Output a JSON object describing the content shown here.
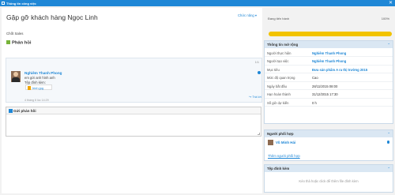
{
  "window": {
    "title": "Thông tin công việc",
    "close_glyph": "✕",
    "icon": "window-icon"
  },
  "task": {
    "title": "Gặp gỡ khách hàng Ngọc Linh",
    "choice_label": "Chức năng ▾",
    "subtitle": "Chốt Sales"
  },
  "feedback": {
    "heading": "Phản hồi",
    "count": "1/1",
    "comment": {
      "author": "Nghiêm Thanh Phong",
      "message": "em gửi anh hình anh",
      "attachments_label": "Tệp đính kèm:",
      "file_name": "hinh.jpg",
      "time": "4 tháng 6 lúc 14:29",
      "reply_label": "↪ Trả lời"
    },
    "compose": {
      "title": "Gửi phản hồi",
      "placeholder": ""
    }
  },
  "progress": {
    "label": "Đang tiến hành",
    "percent_text": "100%",
    "value": 1.0,
    "color": "#f2c300"
  },
  "info": {
    "title": "Thông tin mở rộng",
    "rows": [
      {
        "key": "Người thực hiện",
        "value": "Nghiêm Thanh Phong",
        "link": true
      },
      {
        "key": "Người tạo việc",
        "value": "Nghiêm Thanh Phong",
        "link": true
      },
      {
        "key": "Mục tiêu",
        "value": "Đưa sản phẩm A ra thị trường 2015",
        "link": true
      },
      {
        "key": "Mức độ quan trọng",
        "value": "Cao",
        "link": false
      },
      {
        "key": "Ngày bắt đầu",
        "value": "28/11/2015 08:00",
        "link": false
      },
      {
        "key": "Hạn hoàn thành",
        "value": "31/12/2015 17:30",
        "link": false
      },
      {
        "key": "Số giờ dự kiến",
        "value": "0 h",
        "link": false
      }
    ]
  },
  "coop": {
    "title": "Người phối hợp",
    "member": "Vũ Minh Hải",
    "add_label": "Thêm người phối hợp"
  },
  "attach": {
    "title": "Tệp đính kèm",
    "drop_text": "Kéo thả hoặc click để thêm file đính kèm"
  },
  "colors": {
    "accent": "#1f87d6",
    "panel_head": "#dae7f3",
    "green": "#77b339"
  }
}
